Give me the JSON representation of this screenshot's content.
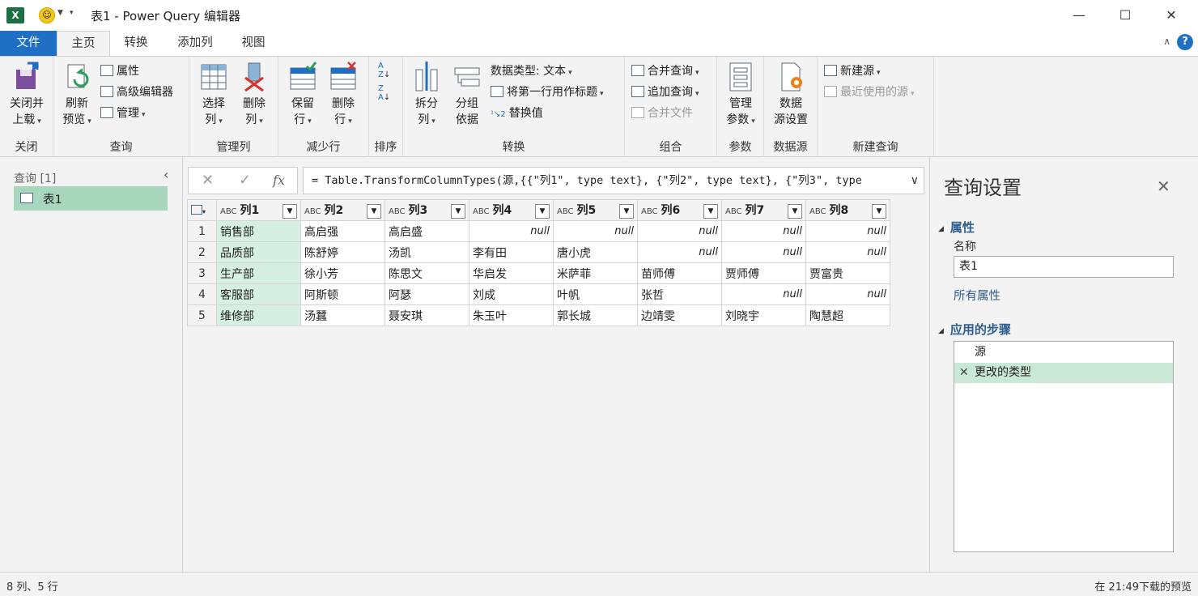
{
  "titlebar": {
    "app_icon": "X",
    "title": "表1 - Power Query 编辑器",
    "minimize": "—",
    "maximize": "☐",
    "close": "✕"
  },
  "tabs": [
    "文件",
    "主页",
    "转换",
    "添加列",
    "视图"
  ],
  "ribbon": {
    "close_group": {
      "btn": [
        "关闭并",
        "上载"
      ],
      "label": "关闭"
    },
    "query_group": {
      "refresh": [
        "刷新",
        "预览"
      ],
      "properties": "属性",
      "advanced_editor": "高级编辑器",
      "manage": "管理",
      "label": "查询"
    },
    "manage_cols_group": {
      "choose": [
        "选择",
        "列"
      ],
      "remove": [
        "删除",
        "列"
      ],
      "label": "管理列"
    },
    "reduce_rows_group": {
      "keep": [
        "保留",
        "行"
      ],
      "remove": [
        "删除",
        "行"
      ],
      "label": "减少行"
    },
    "sort_group": {
      "label": "排序"
    },
    "transform_group": {
      "split": [
        "拆分",
        "列"
      ],
      "group_by": [
        "分组",
        "依据"
      ],
      "data_type": "数据类型: 文本",
      "use_first_row": "将第一行用作标题",
      "replace": "替换值",
      "label": "转换"
    },
    "combine_group": {
      "merge": "合并查询",
      "append": "追加查询",
      "combine_files": "合并文件",
      "label": "组合"
    },
    "params_group": {
      "manage": [
        "管理",
        "参数"
      ],
      "label": "参数"
    },
    "datasource_group": {
      "settings": [
        "数据",
        "源设置"
      ],
      "label": "数据源"
    },
    "new_query_group": {
      "new_source": "新建源",
      "recent": "最近使用的源",
      "label": "新建查询"
    }
  },
  "queries": {
    "header": "查询 [1]",
    "items": [
      "表1"
    ]
  },
  "formula_bar": {
    "formula": "= Table.TransformColumnTypes(源,{{\"列1\", type text}, {\"列2\", type text}, {\"列3\", type"
  },
  "table": {
    "type_glyph": "ABC",
    "columns": [
      "列1",
      "列2",
      "列3",
      "列4",
      "列5",
      "列6",
      "列7",
      "列8"
    ],
    "rows": [
      [
        "销售部",
        "高启强",
        "高启盛",
        "null",
        "null",
        "null",
        "null",
        "null"
      ],
      [
        "品质部",
        "陈舒婷",
        "汤凯",
        "李有田",
        "唐小虎",
        "null",
        "null",
        "null"
      ],
      [
        "生产部",
        "徐小芳",
        "陈思文",
        "华启发",
        "米萨菲",
        "苗师傅",
        "贾师傅",
        "贾富贵"
      ],
      [
        "客服部",
        "阿斯顿",
        "阿瑟",
        "刘成",
        "叶帆",
        "张哲",
        "null",
        "null"
      ],
      [
        "维修部",
        "汤蠶",
        "聂安琪",
        "朱玉叶",
        "郭长城",
        "边靖雯",
        "刘晓宇",
        "陶慧超"
      ]
    ]
  },
  "query_settings": {
    "title": "查询设置",
    "properties_header": "属性",
    "name_label": "名称",
    "name_value": "表1",
    "all_properties": "所有属性",
    "steps_header": "应用的步骤",
    "steps": [
      "源",
      "更改的类型"
    ]
  },
  "status": {
    "left": "8 列、5 行",
    "right": "在 21:49下载的预览"
  }
}
